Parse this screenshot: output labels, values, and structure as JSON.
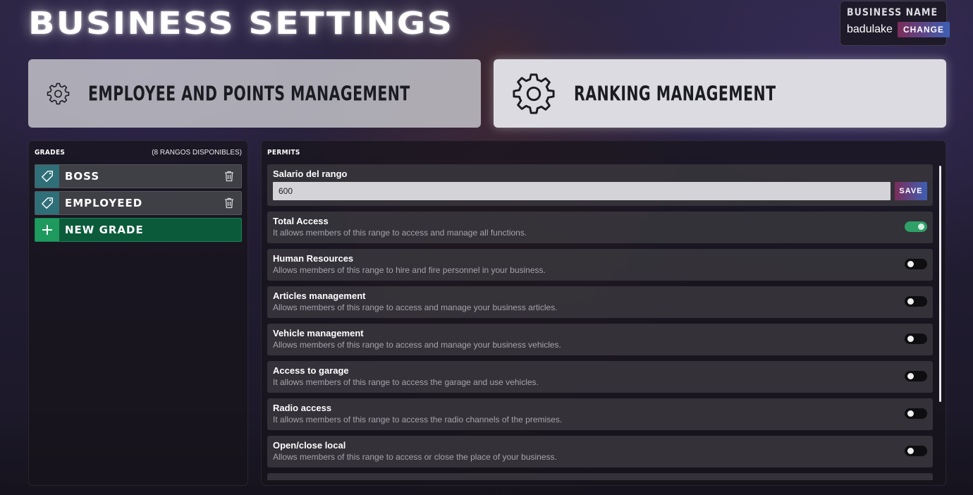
{
  "header": {
    "title": "Business settings"
  },
  "business": {
    "title": "Business name",
    "value": "badulake",
    "change_label": "Change"
  },
  "tabs": [
    {
      "label": "Employee and points management",
      "icon": "gear-icon",
      "active": false
    },
    {
      "label": "Ranking management",
      "icon": "gear-icon",
      "active": true
    }
  ],
  "grades": {
    "title": "Grades",
    "count_label": "(8 rangos disponibles)",
    "items": [
      {
        "label": "Boss",
        "icon": "tag-icon",
        "deletable": true
      },
      {
        "label": "Employeed",
        "icon": "tag-icon",
        "deletable": true
      }
    ],
    "new_label": "New grade"
  },
  "permits": {
    "title": "Permits",
    "salary": {
      "label": "Salario del rango",
      "value": "600",
      "save_label": "Save"
    },
    "items": [
      {
        "title": "Total Access",
        "desc": "It allows members of this range to access and manage all functions.",
        "enabled": true
      },
      {
        "title": "Human Resources",
        "desc": "Allows members of this range to hire and fire personnel in your business.",
        "enabled": false
      },
      {
        "title": "Articles management",
        "desc": "Allows members of this range to access and manage your business articles.",
        "enabled": false
      },
      {
        "title": "Vehicle management",
        "desc": "Allows members of this range to access and manage your business vehicles.",
        "enabled": false
      },
      {
        "title": "Access to garage",
        "desc": "It allows members of this range to access the garage and use vehicles.",
        "enabled": false
      },
      {
        "title": "Radio access",
        "desc": "It allows members of this range to access the radio channels of the premises.",
        "enabled": false
      },
      {
        "title": "Open/close local",
        "desc": "Allows members of this range to access or close the place of your business.",
        "enabled": false
      }
    ]
  },
  "colors": {
    "accent_green": "#2fa067",
    "button_gradient_start": "#7a2d5a",
    "button_gradient_end": "#3e5fb4",
    "grade_icon_bg": "#2f6f78"
  }
}
